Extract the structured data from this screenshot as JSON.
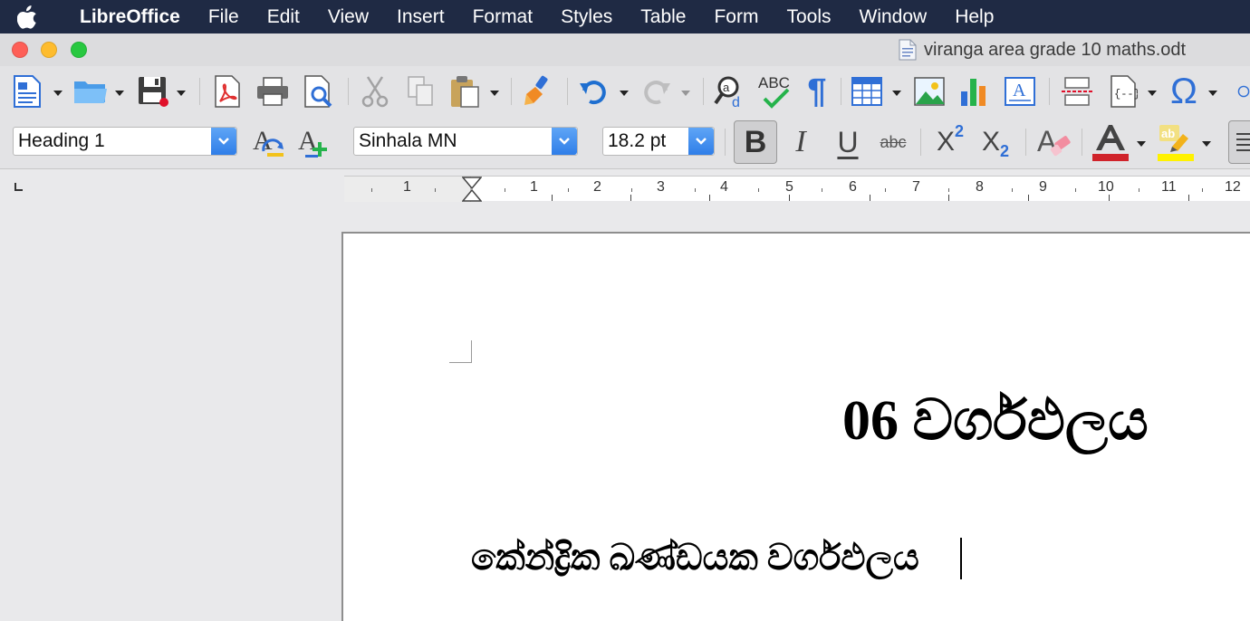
{
  "menubar": {
    "app_name": "LibreOffice",
    "items": [
      "File",
      "Edit",
      "View",
      "Insert",
      "Format",
      "Styles",
      "Table",
      "Form",
      "Tools",
      "Window",
      "Help"
    ]
  },
  "window": {
    "title": "viranga area grade 10 maths.odt",
    "traffic_colors": [
      "#fe5f57",
      "#febc2e",
      "#28c840"
    ]
  },
  "toolbar": {
    "icons": [
      "new-document-icon",
      "open-folder-icon",
      "save-icon",
      "export-pdf-icon",
      "print-icon",
      "print-preview-icon",
      "cut-icon",
      "copy-icon",
      "paste-icon",
      "clone-formatting-icon",
      "undo-icon",
      "redo-icon",
      "find-replace-icon",
      "spelling-icon",
      "formatting-marks-icon",
      "insert-table-icon",
      "insert-image-icon",
      "insert-chart-icon",
      "insert-textbox-icon",
      "page-break-icon",
      "insert-field-icon",
      "special-character-icon"
    ],
    "special_char_glyph": "Ω",
    "spelling_label": "ABC",
    "pilcrow": "¶"
  },
  "formatting": {
    "paragraph_style": "Heading 1",
    "font_name": "Sinhala MN",
    "font_size": "18.2 pt",
    "bold_label": "B",
    "italic_label": "I",
    "underline_label": "U",
    "strikethrough_label": "abc",
    "superscript_base": "X",
    "superscript_exp": "2",
    "subscript_base": "X",
    "subscript_idx": "2",
    "font_color": "#d0232a",
    "highlight_color": "#fff200",
    "highlight_label": "ab"
  },
  "ruler": {
    "labels": [
      "1",
      "1",
      "2",
      "3",
      "4",
      "5",
      "6",
      "7",
      "8",
      "9",
      "10",
      "11",
      "12"
    ]
  },
  "document": {
    "heading": "06 වර්ගඵලය",
    "subheading": "කේන්ද්‍රික ඛණ්ඩයක වර්ගඵලය"
  }
}
